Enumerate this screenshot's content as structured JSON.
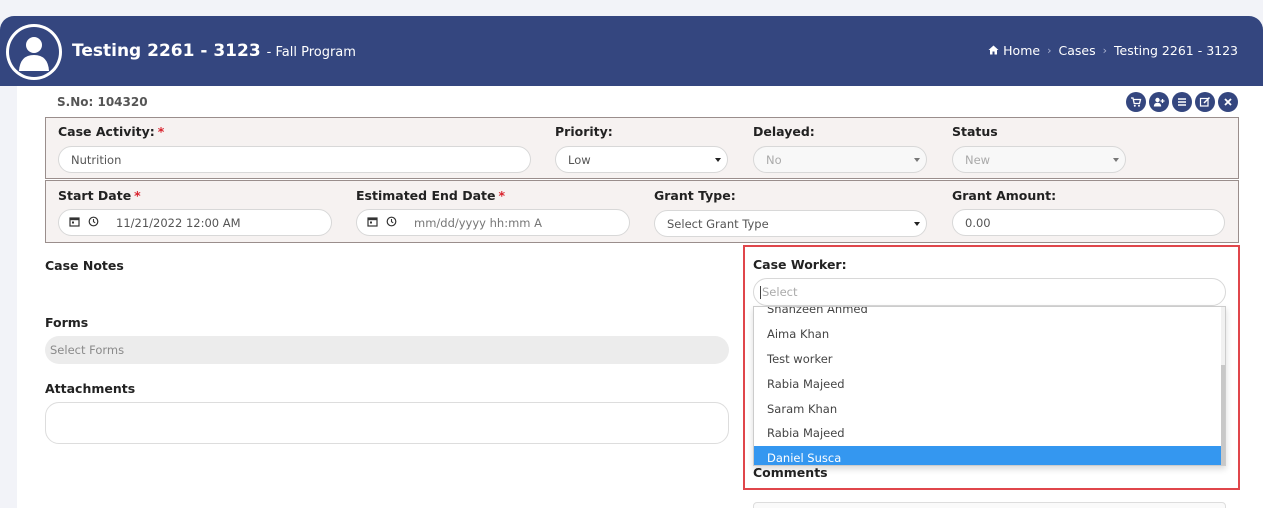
{
  "header": {
    "title": "Testing 2261 - 3123",
    "subtitle": "- Fall Program",
    "breadcrumb": [
      "Home",
      "Cases",
      "Testing 2261 - 3123"
    ],
    "breadcrumb_icon": "home-icon",
    "avatar_icon": "user-avatar-icon",
    "color": "#34467f"
  },
  "record": {
    "serial_label": "S.No: 104320"
  },
  "actions": [
    {
      "name": "cart-icon"
    },
    {
      "name": "add-user-icon"
    },
    {
      "name": "list-icon"
    },
    {
      "name": "edit-icon"
    },
    {
      "name": "close-icon"
    }
  ],
  "form": {
    "case_activity": {
      "label": "Case Activity:",
      "required": "*",
      "value": "Nutrition"
    },
    "priority": {
      "label": "Priority:",
      "value": "Low"
    },
    "delayed": {
      "label": "Delayed:",
      "value": "No"
    },
    "status": {
      "label": "Status",
      "value": "New"
    },
    "start_date": {
      "label": "Start Date",
      "required": "*",
      "value": "11/21/2022 12:00 AM",
      "icons": [
        "calendar-icon",
        "clock-icon"
      ]
    },
    "end_date": {
      "label": "Estimated End Date",
      "required": "*",
      "placeholder": "mm/dd/yyyy hh:mm A",
      "icons": [
        "calendar-icon",
        "clock-icon"
      ]
    },
    "grant_type": {
      "label": "Grant Type:",
      "value": "Select Grant Type"
    },
    "grant_amount": {
      "label": "Grant Amount:",
      "value": "0.00"
    }
  },
  "sections": {
    "case_notes": "Case Notes",
    "forms": "Forms",
    "forms_placeholder": "Select Forms",
    "attachments": "Attachments",
    "comments": "Comments"
  },
  "case_worker": {
    "label": "Case Worker:",
    "placeholder": "Select",
    "options": [
      "Shahzeen Ahmed",
      "Aima Khan",
      "Test worker",
      "Rabia Majeed",
      "Saram Khan",
      "Rabia Majeed",
      "Daniel Susca"
    ],
    "highlighted": "Daniel Susca",
    "highlight_color": "#3497f0",
    "annotation_color": "#e0464b"
  }
}
